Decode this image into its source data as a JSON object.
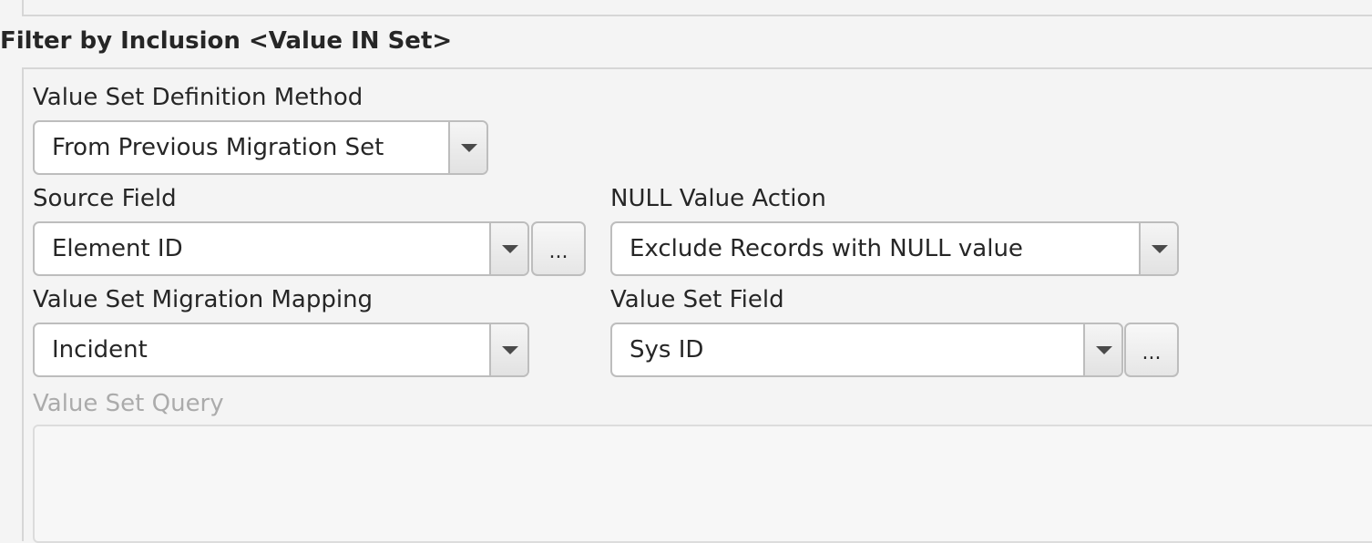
{
  "section": {
    "title": "Filter by Inclusion <Value IN Set>"
  },
  "value_set_definition_method": {
    "label": "Value Set Definition Method",
    "selected": "From Previous Migration Set"
  },
  "source_field": {
    "label": "Source Field",
    "selected": "Element ID",
    "browse_label": "..."
  },
  "null_value_action": {
    "label": "NULL Value Action",
    "selected": "Exclude Records with NULL value"
  },
  "value_set_migration_mapping": {
    "label": "Value Set Migration Mapping",
    "selected": "Incident"
  },
  "value_set_field": {
    "label": "Value Set Field",
    "selected": "Sys ID",
    "browse_label": "..."
  },
  "value_set_query": {
    "label": "Value Set Query",
    "value": "",
    "enabled": false
  },
  "icons": {
    "dropdown": "chevron-down-icon"
  }
}
